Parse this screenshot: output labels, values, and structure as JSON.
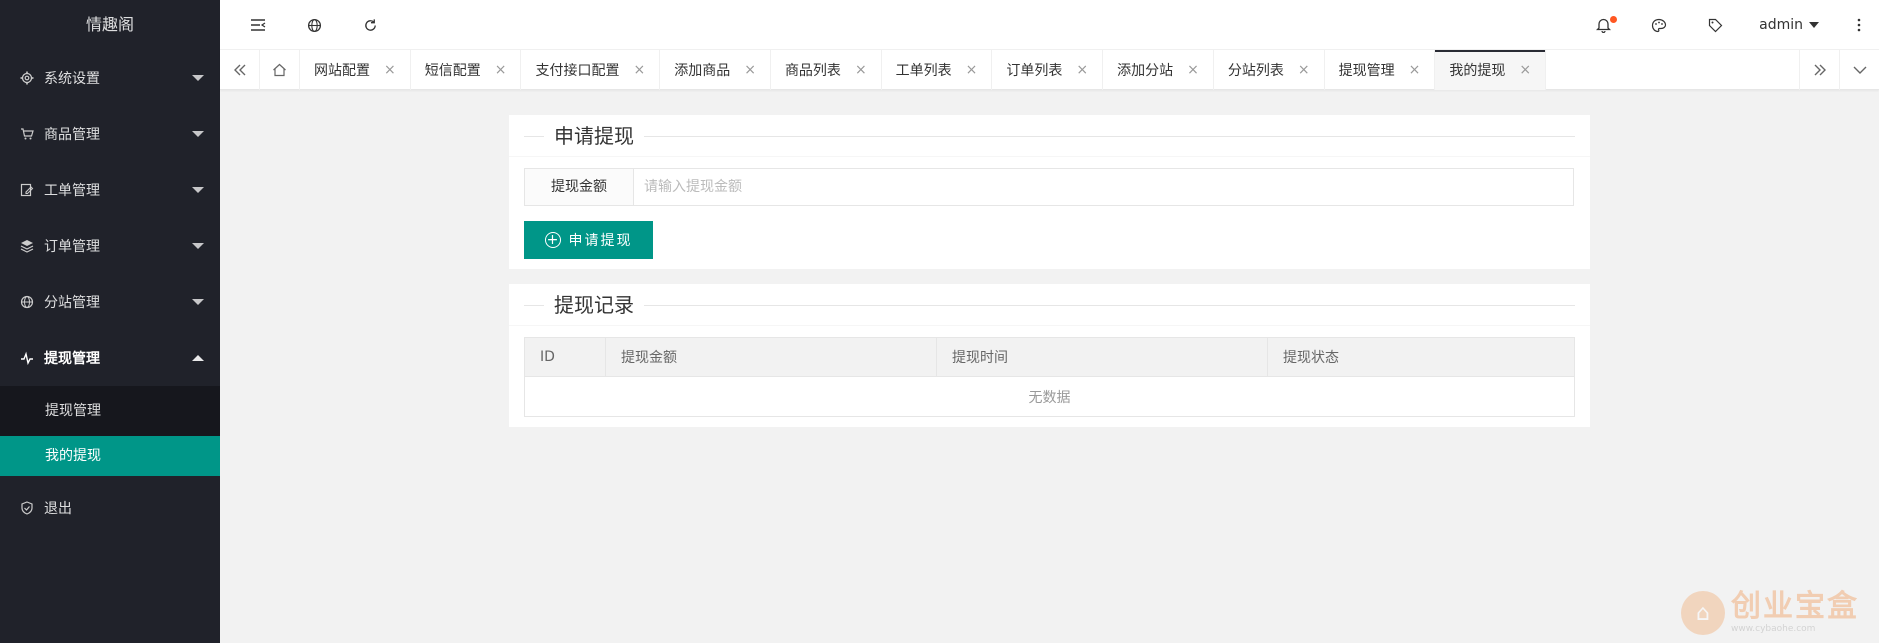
{
  "sidebar": {
    "brand": "情趣阁",
    "items": [
      {
        "label": "系统设置",
        "icon": "gear-icon"
      },
      {
        "label": "商品管理",
        "icon": "cart-icon"
      },
      {
        "label": "工单管理",
        "icon": "edit-icon"
      },
      {
        "label": "订单管理",
        "icon": "layers-icon"
      },
      {
        "label": "分站管理",
        "icon": "globe-icon"
      },
      {
        "label": "提现管理",
        "icon": "pulse-icon"
      }
    ],
    "sub_items": [
      {
        "label": "提现管理"
      },
      {
        "label": "我的提现"
      }
    ],
    "logout": "退出"
  },
  "header": {
    "user": "admin"
  },
  "tabs": [
    "网站配置",
    "短信配置",
    "支付接口配置",
    "添加商品",
    "商品列表",
    "工单列表",
    "订单列表",
    "添加分站",
    "分站列表",
    "提现管理",
    "我的提现"
  ],
  "apply": {
    "title": "申请提现",
    "amount_label": "提现金额",
    "amount_placeholder": "请输入提现金额",
    "amount_value": "",
    "submit_label": "申请提现"
  },
  "records": {
    "title": "提现记录",
    "columns": [
      "ID",
      "提现金额",
      "提现时间",
      "提现状态"
    ],
    "empty_text": "无数据"
  },
  "watermark": {
    "brand": "创业宝盒",
    "url": "www.cybaohe.com"
  },
  "colors": {
    "sidebar_bg": "#20222a",
    "accent": "#009688",
    "notify_dot": "#ff5722"
  }
}
